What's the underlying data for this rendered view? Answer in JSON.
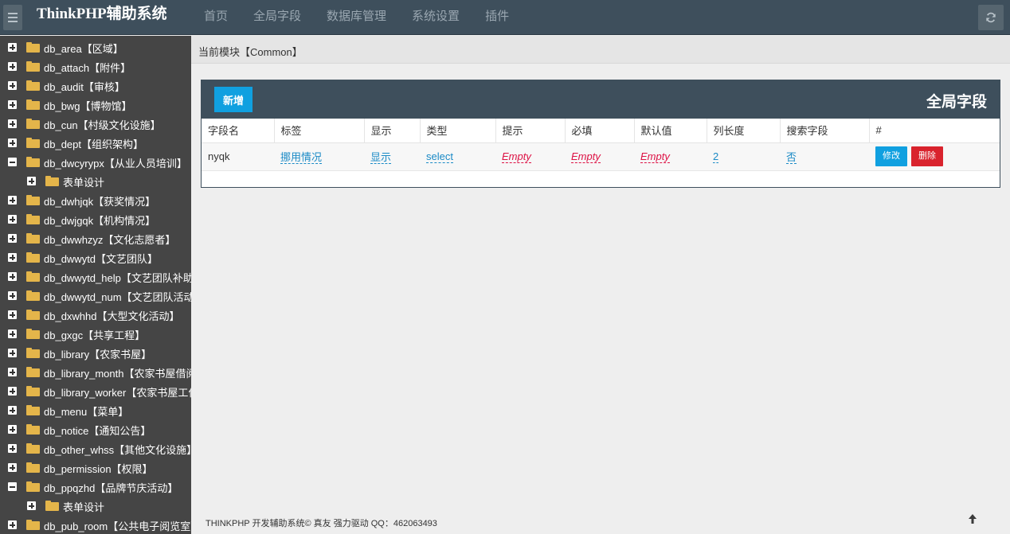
{
  "app": {
    "brand": "ThinkPHP辅助系统"
  },
  "nav": [
    "首页",
    "全局字段",
    "数据库管理",
    "系统设置",
    "插件"
  ],
  "sidebar": {
    "items": [
      {
        "label": "db_area【区域】",
        "level": 0,
        "expanded": false
      },
      {
        "label": "db_attach【附件】",
        "level": 0,
        "expanded": false
      },
      {
        "label": "db_audit【审核】",
        "level": 0,
        "expanded": false
      },
      {
        "label": "db_bwg【博物馆】",
        "level": 0,
        "expanded": false
      },
      {
        "label": "db_cun【村级文化设施】",
        "level": 0,
        "expanded": false
      },
      {
        "label": "db_dept【组织架构】",
        "level": 0,
        "expanded": false
      },
      {
        "label": "db_dwcyrypx【从业人员培训】",
        "level": 0,
        "expanded": true
      },
      {
        "label": "表单设计",
        "level": 1,
        "expanded": false
      },
      {
        "label": "db_dwhjqk【获奖情况】",
        "level": 0,
        "expanded": false
      },
      {
        "label": "db_dwjgqk【机构情况】",
        "level": 0,
        "expanded": false
      },
      {
        "label": "db_dwwhzyz【文化志愿者】",
        "level": 0,
        "expanded": false
      },
      {
        "label": "db_dwwytd【文艺团队】",
        "level": 0,
        "expanded": false
      },
      {
        "label": "db_dwwytd_help【文艺团队补助",
        "level": 0,
        "expanded": false
      },
      {
        "label": "db_dwwytd_num【文艺团队活动",
        "level": 0,
        "expanded": false
      },
      {
        "label": "db_dxwhhd【大型文化活动】",
        "level": 0,
        "expanded": false
      },
      {
        "label": "db_gxgc【共享工程】",
        "level": 0,
        "expanded": false
      },
      {
        "label": "db_library【农家书屋】",
        "level": 0,
        "expanded": false
      },
      {
        "label": "db_library_month【农家书屋借阅",
        "level": 0,
        "expanded": false
      },
      {
        "label": "db_library_worker【农家书屋工作",
        "level": 0,
        "expanded": false
      },
      {
        "label": "db_menu【菜单】",
        "level": 0,
        "expanded": false
      },
      {
        "label": "db_notice【通知公告】",
        "level": 0,
        "expanded": false
      },
      {
        "label": "db_other_whss【其他文化设施】",
        "level": 0,
        "expanded": false
      },
      {
        "label": "db_permission【权限】",
        "level": 0,
        "expanded": false
      },
      {
        "label": "db_ppqzhd【品牌节庆活动】",
        "level": 0,
        "expanded": true
      },
      {
        "label": "表单设计",
        "level": 1,
        "expanded": false
      },
      {
        "label": "db_pub_room【公共电子阅览室】",
        "level": 0,
        "expanded": false
      }
    ]
  },
  "module_bar": {
    "text": "当前模块【Common】"
  },
  "panel": {
    "add_label": "新增",
    "title": "全局字段",
    "columns": [
      "字段名",
      "标签",
      "显示",
      "类型",
      "提示",
      "必填",
      "默认值",
      "列长度",
      "搜索字段",
      "#"
    ],
    "rows": [
      {
        "name": "nyqk",
        "label": "挪用情况",
        "display": "显示",
        "type": "select",
        "hint": "Empty",
        "required": "Empty",
        "default": "Empty",
        "col_length": "2",
        "search": "否",
        "edit_label": "修改",
        "delete_label": "删除"
      }
    ]
  },
  "footer": {
    "text": "THINKPHP 开发辅助系统© 真友 强力驱动 QQ：462063493"
  },
  "icons": {
    "menu": "hamburger-icon",
    "refresh": "refresh-icon",
    "folder": "folder-icon",
    "scroll_top": "arrow-up-icon"
  },
  "colors": {
    "topbar": "#3e4f5c",
    "sidebar": "#454545",
    "primary": "#10a0e0",
    "danger": "#d9232d",
    "folder": "#e4b54a"
  }
}
